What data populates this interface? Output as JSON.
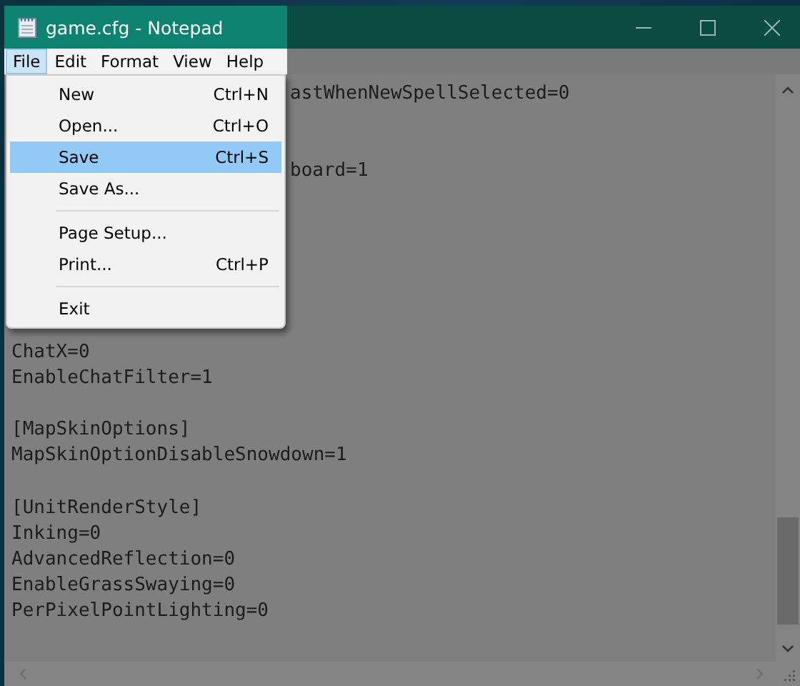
{
  "window": {
    "title": "game.cfg - Notepad"
  },
  "menu_bar": [
    {
      "label": "File",
      "selected": true
    },
    {
      "label": "Edit",
      "selected": false
    },
    {
      "label": "Format",
      "selected": false
    },
    {
      "label": "View",
      "selected": false
    },
    {
      "label": "Help",
      "selected": false
    }
  ],
  "file_menu": [
    {
      "kind": "item",
      "label": "New",
      "shortcut": "Ctrl+N",
      "selected": false
    },
    {
      "kind": "item",
      "label": "Open...",
      "shortcut": "Ctrl+O",
      "selected": false
    },
    {
      "kind": "item",
      "label": "Save",
      "shortcut": "Ctrl+S",
      "selected": true
    },
    {
      "kind": "item",
      "label": "Save As...",
      "selected": false
    },
    {
      "kind": "separator"
    },
    {
      "kind": "item",
      "label": "Page Setup...",
      "selected": false
    },
    {
      "kind": "item",
      "label": "Print...",
      "shortcut": "Ctrl+P",
      "selected": false
    },
    {
      "kind": "separator"
    },
    {
      "kind": "item",
      "label": "Exit",
      "selected": false
    }
  ],
  "editor_lines": [
    {
      "kind": "partial",
      "text": "astWhenNewSpellSelected=0"
    },
    {
      "kind": "blank"
    },
    {
      "kind": "blank"
    },
    {
      "kind": "partial",
      "text": "board=1"
    },
    {
      "kind": "blank"
    },
    {
      "kind": "blank"
    },
    {
      "kind": "blank"
    },
    {
      "kind": "blank"
    },
    {
      "kind": "blank"
    },
    {
      "kind": "blank"
    },
    {
      "kind": "full",
      "text": "ChatX=0"
    },
    {
      "kind": "full",
      "text": "EnableChatFilter=1"
    },
    {
      "kind": "blank"
    },
    {
      "kind": "full",
      "text": "[MapSkinOptions]"
    },
    {
      "kind": "full",
      "text": "MapSkinOptionDisableSnowdown=1"
    },
    {
      "kind": "blank"
    },
    {
      "kind": "full",
      "text": "[UnitRenderStyle]"
    },
    {
      "kind": "full",
      "text": "Inking=0"
    },
    {
      "kind": "full",
      "text": "AdvancedReflection=0"
    },
    {
      "kind": "full",
      "text": "EnableGrassSwaying=0"
    },
    {
      "kind": "full",
      "text": "PerPixelPointLighting=0"
    }
  ]
}
